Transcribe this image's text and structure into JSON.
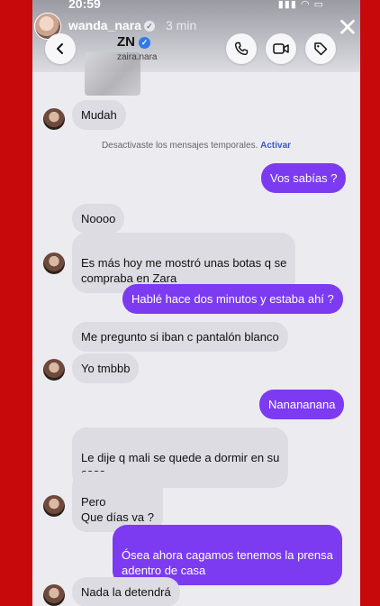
{
  "story": {
    "status_time": "20:59",
    "username": "wanda_nara",
    "time_ago": "3 min"
  },
  "chat": {
    "contact_name": "ZN",
    "contact_handle": "zaira.nara",
    "system_notice": "Desactivaste los mensajes temporales.",
    "system_action": "Activar"
  },
  "messages": [
    {
      "dir": "in",
      "text": "Mudah"
    },
    {
      "dir": "out",
      "text": "Vos sabías ?"
    },
    {
      "dir": "in",
      "text": "Noooo"
    },
    {
      "dir": "in",
      "text": "Es más hoy me mostró unas botas q se\ncompraba en Zara"
    },
    {
      "dir": "out",
      "text": "Hablé hace dos minutos y estaba ahí ?"
    },
    {
      "dir": "in",
      "text": "Me pregunto si iban c pantalón blanco"
    },
    {
      "dir": "in",
      "text": "Yo tmbbb"
    },
    {
      "dir": "out",
      "text": "Nanananana"
    },
    {
      "dir": "in",
      "text": "Le dije q mali se quede a dormir en su\ncasa"
    },
    {
      "dir": "in",
      "text": "Pero\nQue días va ?"
    },
    {
      "dir": "out",
      "text": "Ósea ahora cagamos tenemos la prensa\nadentro de casa"
    },
    {
      "dir": "in",
      "text": "Nada la detendrá"
    }
  ],
  "colors": {
    "frame_red": "#c8090b",
    "outgoing_bubble": "#7c3bf0",
    "incoming_bubble": "#dcdce2",
    "verified_blue": "#2f78f0"
  }
}
